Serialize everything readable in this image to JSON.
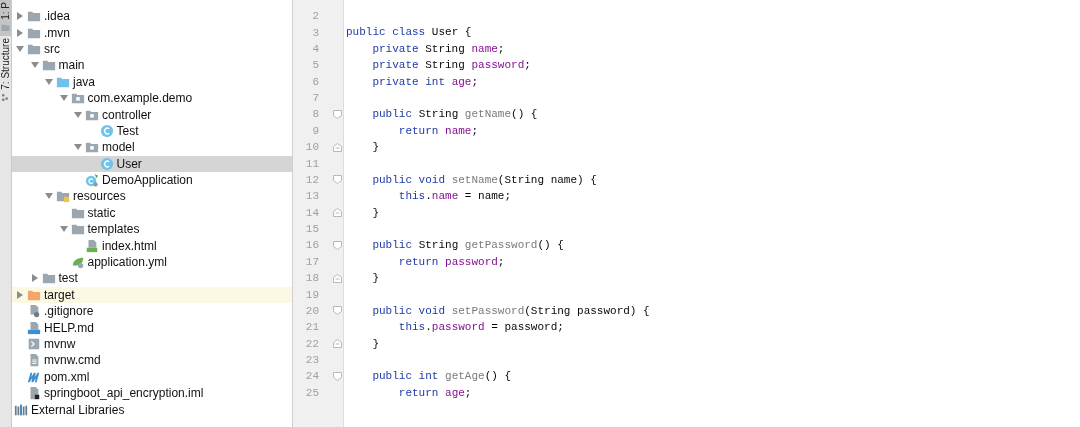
{
  "tool_tabs": [
    {
      "label": "1: P",
      "kind": "folder",
      "selected": true
    },
    {
      "label": "7: Structure",
      "kind": "structure",
      "selected": false
    }
  ],
  "tree": [
    {
      "label": ".idea",
      "kind": "folder",
      "expanded": false,
      "selected": false,
      "highlighted": false
    },
    {
      "label": ".mvn",
      "kind": "folder",
      "expanded": false,
      "selected": false,
      "highlighted": false
    },
    {
      "label": "src",
      "kind": "folder",
      "expanded": true,
      "selected": false,
      "highlighted": false,
      "children": [
        {
          "label": "main",
          "kind": "folder",
          "expanded": true,
          "selected": false,
          "highlighted": false,
          "children": [
            {
              "label": "java",
              "kind": "source",
              "expanded": true,
              "selected": false,
              "highlighted": false,
              "children": [
                {
                  "label": "com.example.demo",
                  "kind": "package",
                  "expanded": true,
                  "selected": false,
                  "highlighted": false,
                  "children": [
                    {
                      "label": "controller",
                      "kind": "package",
                      "expanded": true,
                      "selected": false,
                      "highlighted": false,
                      "children": [
                        {
                          "label": "Test",
                          "kind": "class",
                          "selected": false,
                          "highlighted": false
                        }
                      ]
                    },
                    {
                      "label": "model",
                      "kind": "package",
                      "expanded": true,
                      "selected": false,
                      "highlighted": false,
                      "children": [
                        {
                          "label": "User",
                          "kind": "class",
                          "selected": true,
                          "highlighted": false
                        }
                      ]
                    },
                    {
                      "label": "DemoApplication",
                      "kind": "spring",
                      "selected": false,
                      "highlighted": false
                    }
                  ]
                }
              ]
            },
            {
              "label": "resources",
              "kind": "resources",
              "expanded": true,
              "selected": false,
              "highlighted": false,
              "children": [
                {
                  "label": "static",
                  "kind": "folder",
                  "selected": false,
                  "highlighted": false
                },
                {
                  "label": "templates",
                  "kind": "folder",
                  "expanded": true,
                  "selected": false,
                  "highlighted": false,
                  "children": [
                    {
                      "label": "index.html",
                      "kind": "html",
                      "selected": false,
                      "highlighted": false
                    }
                  ]
                },
                {
                  "label": "application.yml",
                  "kind": "yml",
                  "selected": false,
                  "highlighted": false
                }
              ]
            }
          ]
        },
        {
          "label": "test",
          "kind": "folder",
          "expanded": false,
          "selected": false,
          "highlighted": false
        }
      ]
    },
    {
      "label": "target",
      "kind": "excluded",
      "expanded": false,
      "selected": false,
      "highlighted": true
    },
    {
      "label": ".gitignore",
      "kind": "ignore",
      "selected": false,
      "highlighted": false
    },
    {
      "label": "HELP.md",
      "kind": "md",
      "selected": false,
      "highlighted": false
    },
    {
      "label": "mvnw",
      "kind": "shell",
      "selected": false,
      "highlighted": false
    },
    {
      "label": "mvnw.cmd",
      "kind": "text",
      "selected": false,
      "highlighted": false
    },
    {
      "label": "pom.xml",
      "kind": "maven",
      "selected": false,
      "highlighted": false
    },
    {
      "label": "springboot_api_encryption.iml",
      "kind": "iml",
      "selected": false,
      "highlighted": false
    }
  ],
  "libraries": {
    "label": "External Libraries"
  },
  "code_lines": [
    {
      "number": "2"
    },
    {
      "number": "3",
      "tokens": [
        {
          "kind": "kw",
          "text": "public class "
        },
        {
          "kind": "plain",
          "text": "User {"
        }
      ]
    },
    {
      "number": "4",
      "tokens": [
        {
          "kind": "kw",
          "text": "    private "
        },
        {
          "kind": "plain",
          "text": "String "
        },
        {
          "kind": "field",
          "text": "name"
        },
        {
          "kind": "plain",
          "text": ";"
        }
      ]
    },
    {
      "number": "5",
      "tokens": [
        {
          "kind": "kw",
          "text": "    private "
        },
        {
          "kind": "plain",
          "text": "String "
        },
        {
          "kind": "field",
          "text": "password"
        },
        {
          "kind": "plain",
          "text": ";"
        }
      ]
    },
    {
      "number": "6",
      "tokens": [
        {
          "kind": "kw",
          "text": "    private int "
        },
        {
          "kind": "field",
          "text": "age"
        },
        {
          "kind": "plain",
          "text": ";"
        }
      ]
    },
    {
      "number": "7"
    },
    {
      "number": "8",
      "kind": "fold_start",
      "tokens": [
        {
          "kind": "kw",
          "text": "    public "
        },
        {
          "kind": "plain",
          "text": "String "
        },
        {
          "kind": "method",
          "text": "getName"
        },
        {
          "kind": "plain",
          "text": "() {"
        }
      ]
    },
    {
      "number": "9",
      "tokens": [
        {
          "kind": "kw",
          "text": "        return "
        },
        {
          "kind": "field",
          "text": "name"
        },
        {
          "kind": "plain",
          "text": ";"
        }
      ]
    },
    {
      "number": "10",
      "kind": "fold_end",
      "tokens": [
        {
          "kind": "plain",
          "text": "    }"
        }
      ]
    },
    {
      "number": "11"
    },
    {
      "number": "12",
      "kind": "fold_start",
      "tokens": [
        {
          "kind": "kw",
          "text": "    public void "
        },
        {
          "kind": "method",
          "text": "setName"
        },
        {
          "kind": "plain",
          "text": "(String name) {"
        }
      ]
    },
    {
      "number": "13",
      "tokens": [
        {
          "kind": "kw",
          "text": "        this"
        },
        {
          "kind": "plain",
          "text": "."
        },
        {
          "kind": "field",
          "text": "name"
        },
        {
          "kind": "plain",
          "text": " = name;"
        }
      ]
    },
    {
      "number": "14",
      "kind": "fold_end",
      "tokens": [
        {
          "kind": "plain",
          "text": "    }"
        }
      ]
    },
    {
      "number": "15"
    },
    {
      "number": "16",
      "kind": "fold_start",
      "tokens": [
        {
          "kind": "kw",
          "text": "    public "
        },
        {
          "kind": "plain",
          "text": "String "
        },
        {
          "kind": "method",
          "text": "getPassword"
        },
        {
          "kind": "plain",
          "text": "() {"
        }
      ]
    },
    {
      "number": "17",
      "tokens": [
        {
          "kind": "kw",
          "text": "        return "
        },
        {
          "kind": "field",
          "text": "password"
        },
        {
          "kind": "plain",
          "text": ";"
        }
      ]
    },
    {
      "number": "18",
      "kind": "fold_end",
      "tokens": [
        {
          "kind": "plain",
          "text": "    }"
        }
      ]
    },
    {
      "number": "19"
    },
    {
      "number": "20",
      "kind": "fold_start",
      "tokens": [
        {
          "kind": "kw",
          "text": "    public void "
        },
        {
          "kind": "method",
          "text": "setPassword"
        },
        {
          "kind": "plain",
          "text": "(String password) {"
        }
      ]
    },
    {
      "number": "21",
      "tokens": [
        {
          "kind": "kw",
          "text": "        this"
        },
        {
          "kind": "plain",
          "text": "."
        },
        {
          "kind": "field",
          "text": "password"
        },
        {
          "kind": "plain",
          "text": " = password;"
        }
      ]
    },
    {
      "number": "22",
      "kind": "fold_end",
      "tokens": [
        {
          "kind": "plain",
          "text": "    }"
        }
      ]
    },
    {
      "number": "23"
    },
    {
      "number": "24",
      "kind": "fold_start",
      "tokens": [
        {
          "kind": "kw",
          "text": "    public int "
        },
        {
          "kind": "method",
          "text": "getAge"
        },
        {
          "kind": "plain",
          "text": "() {"
        }
      ]
    },
    {
      "number": "25",
      "tokens": [
        {
          "kind": "kw",
          "text": "        return "
        },
        {
          "kind": "field",
          "text": "age"
        },
        {
          "kind": "plain",
          "text": ";"
        }
      ]
    }
  ]
}
